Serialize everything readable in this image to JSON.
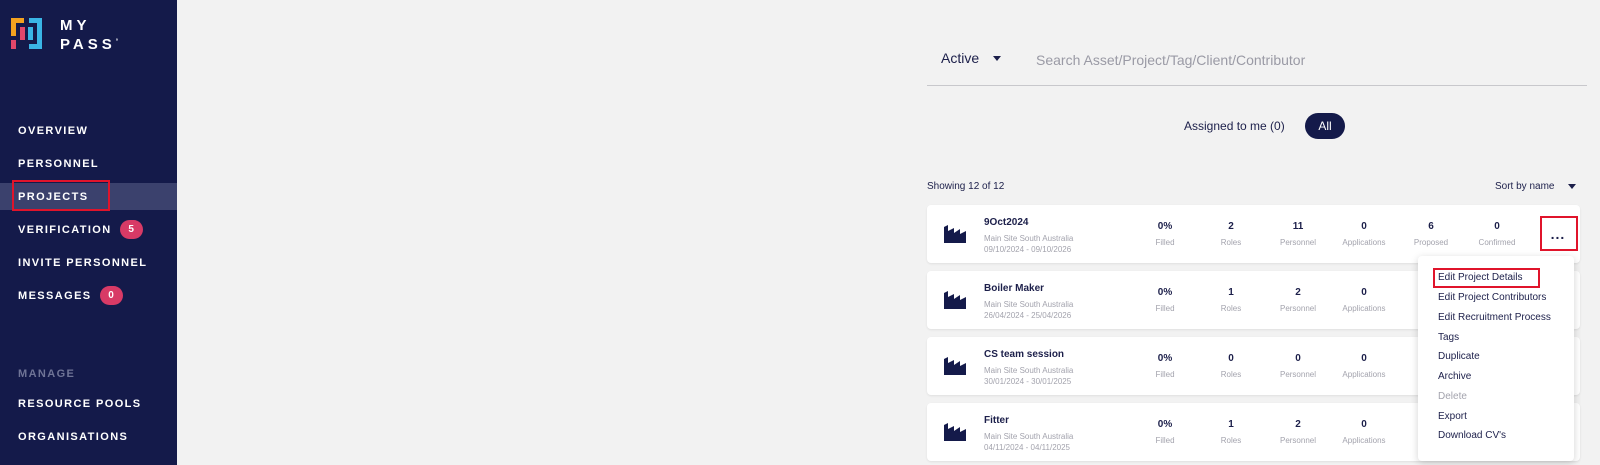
{
  "brand": {
    "line1": "MY",
    "line2": "PASS",
    "mark": "°"
  },
  "nav": {
    "items": [
      {
        "label": "OVERVIEW"
      },
      {
        "label": "PERSONNEL"
      },
      {
        "label": "PROJECTS"
      },
      {
        "label": "VERIFICATION",
        "badge": "5"
      },
      {
        "label": "INVITE PERSONNEL"
      },
      {
        "label": "MESSAGES",
        "badge": "0"
      }
    ],
    "section_label": "MANAGE",
    "manage_items": [
      {
        "label": "RESOURCE POOLS"
      },
      {
        "label": "ORGANISATIONS"
      }
    ]
  },
  "toolbar": {
    "status_value": "Active",
    "search_placeholder": "Search Asset/Project/Tag/Client/Contributor",
    "filter_assigned": "Assigned to me (0)",
    "filter_all": "All",
    "showing": "Showing 12 of 12",
    "sort_value": "Sort by name"
  },
  "stat_labels": [
    "Filled",
    "Roles",
    "Personnel",
    "Applications",
    "Proposed",
    "Confirmed"
  ],
  "projects": [
    {
      "name": "9Oct2024",
      "site": "Main Site South Australia",
      "dates": "09/10/2024 - 09/10/2026",
      "stats": [
        "0%",
        "2",
        "11",
        "0",
        "6",
        "0"
      ]
    },
    {
      "name": "Boiler Maker",
      "site": "Main Site South Australia",
      "dates": "26/04/2024 - 25/04/2026",
      "stats": [
        "0%",
        "1",
        "2",
        "0"
      ]
    },
    {
      "name": "CS team session",
      "site": "Main Site South Australia",
      "dates": "30/01/2024 - 30/01/2025",
      "stats": [
        "0%",
        "0",
        "0",
        "0"
      ]
    },
    {
      "name": "Fitter",
      "site": "Main Site South Australia",
      "dates": "04/11/2024 - 04/11/2025",
      "stats": [
        "0%",
        "1",
        "2",
        "0"
      ]
    }
  ],
  "more_label": "...",
  "menu": {
    "items": [
      {
        "label": "Edit Project Details"
      },
      {
        "label": "Edit Project Contributors"
      },
      {
        "label": "Edit Recruitment Process"
      },
      {
        "label": "Tags"
      },
      {
        "label": "Duplicate"
      },
      {
        "label": "Archive"
      },
      {
        "label": "Delete",
        "disabled": true
      },
      {
        "label": "Export"
      },
      {
        "label": "Download CV's"
      }
    ]
  },
  "colors": {
    "sidebar": "#141a4a",
    "active_nav": "#3b416d",
    "badge": "#d83a66",
    "highlight": "#e0142b",
    "text": "#1c1f4a"
  }
}
